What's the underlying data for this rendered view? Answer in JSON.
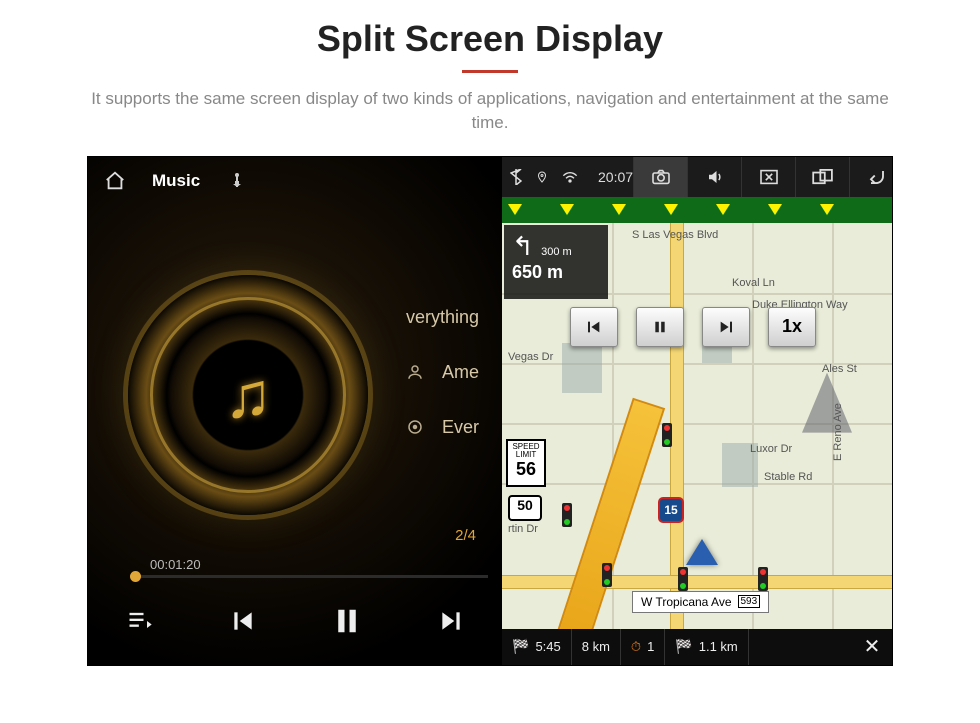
{
  "page": {
    "title": "Split Screen Display",
    "subtitle": "It supports the same screen display of two kinds of applications, navigation and entertainment at the same time."
  },
  "music": {
    "app_label": "Music",
    "track_title": "verything",
    "artist": "Ame",
    "album": "Ever",
    "track_index": "2/4",
    "elapsed": "00:01:20"
  },
  "status": {
    "clock": "20:07"
  },
  "nav": {
    "turn_dist_small": "300 m",
    "turn_dist_big": "650 m",
    "speed_btn": "1x",
    "speed_limit_label": "SPEED LIMIT",
    "speed_limit_value": "56",
    "route_shield": "50",
    "interstate": "15",
    "tropicana_label": "W Tropicana Ave",
    "tropicana_num": "593",
    "streets": {
      "slv": "S Las Vegas Blvd",
      "koval": "Koval Ln",
      "duke": "Duke Ellington Way",
      "vegas_dr": "Vegas Dr",
      "ales": "Ales St",
      "luxor": "Luxor Dr",
      "stable": "Stable Rd",
      "reno": "E Reno Ave",
      "martin": "rtin Dr"
    },
    "footer": {
      "eta": "5:45",
      "speed": "8 km",
      "cost_icon_val": "1",
      "dist": "1.1 km"
    }
  }
}
